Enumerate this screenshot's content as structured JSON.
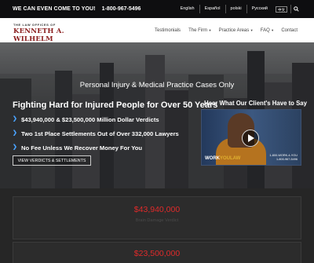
{
  "topbar": {
    "promo": "WE CAN EVEN COME TO YOU!",
    "phone": "1-800-967-5496",
    "languages": [
      "English",
      "Español",
      "polski",
      "Русский",
      "中文"
    ]
  },
  "header": {
    "logo_line1": "THE LAW OFFICES OF",
    "logo_line2": "KENNETH A. WILHELM",
    "menu": [
      {
        "label": "Testimonials",
        "dropdown": false
      },
      {
        "label": "The Firm",
        "dropdown": true
      },
      {
        "label": "Practice Areas",
        "dropdown": true
      },
      {
        "label": "FAQ",
        "dropdown": true
      },
      {
        "label": "Contact",
        "dropdown": false
      }
    ]
  },
  "hero": {
    "title": "Personal Injury & Medical Practice Cases Only",
    "heading": "Fighting Hard for Injured People for Over 50 Years",
    "bullets": [
      "$43,940,000 & $23,500,000 Million Dollar Verdicts",
      "Two 1st Place Settlements Out of Over 332,000 Lawyers",
      "No Fee Unless We Recover Money For You"
    ],
    "button": "VIEW VERDICTS & SETTLEMENTS",
    "video_title": "Hear What Our Client's Have to Say",
    "video_brand_a": "WORK",
    "video_brand_b": "YOULAW",
    "video_phone_1": "1-800-WORK-4-YOU",
    "video_phone_2": "1-800-967-5496"
  },
  "verdicts": [
    {
      "amount": "$43,940,000",
      "description": "Brain Damage Verdict"
    },
    {
      "amount": "$23,500,000",
      "description": ""
    }
  ],
  "colors": {
    "accent_red": "#e02a2a",
    "brand_red": "#8b1e1e",
    "bullet_blue": "#4aa3ff"
  }
}
